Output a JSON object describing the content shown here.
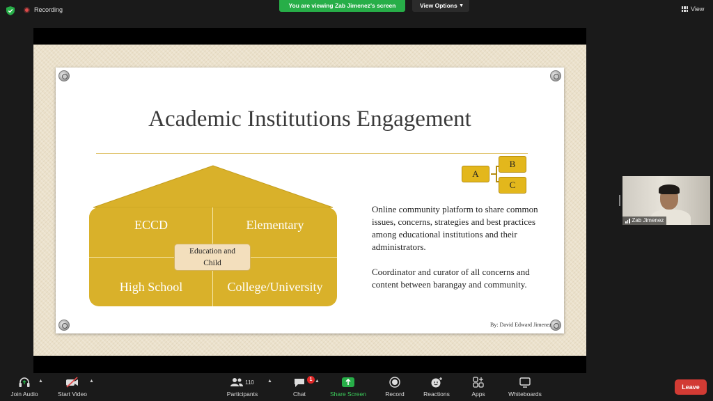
{
  "topbar": {
    "recording_label": "Recording",
    "viewing_banner": "You are viewing Zab Jimenez's screen",
    "view_options_label": "View Options",
    "view_label": "View"
  },
  "slide": {
    "title": "Academic Institutions Engagement",
    "quadrants": [
      "ECCD",
      "Elementary",
      "High School",
      "College/University"
    ],
    "center_label_line1": "Education and",
    "center_label_line2": "Child",
    "abc": [
      "A",
      "B",
      "C"
    ],
    "paragraphs": [
      "Online community platform to share common issues, concerns, strategies and best practices among educational institutions and their administrators.",
      "Coordinator and curator of all concerns and content between barangay and community."
    ],
    "byline": "By: David Edward Jimenez"
  },
  "participant_tile": {
    "name": "Zab Jimenez"
  },
  "toolbar": {
    "join_audio": "Join Audio",
    "start_video": "Start Video",
    "participants": "Participants",
    "participants_count": "110",
    "chat": "Chat",
    "chat_badge": "1",
    "share_screen": "Share Screen",
    "record": "Record",
    "reactions": "Reactions",
    "apps": "Apps",
    "whiteboards": "Whiteboards",
    "leave": "Leave"
  },
  "colors": {
    "accent_green": "#27ae48",
    "leave_red": "#d23b34",
    "house_gold": "#d9b12a"
  }
}
